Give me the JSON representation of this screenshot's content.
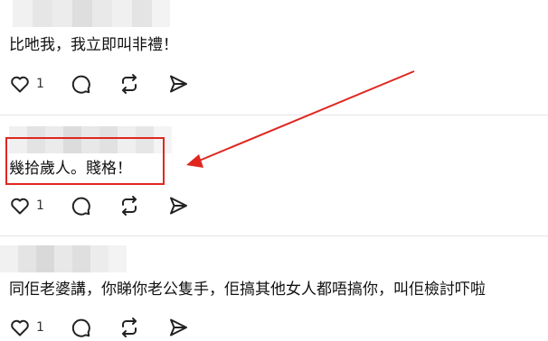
{
  "posts": [
    {
      "text": "比吔我，我立即叫非禮！",
      "like_count": "1"
    },
    {
      "text": "幾拾歲人。賤格！",
      "like_count": "1"
    },
    {
      "text": "同佢老婆講，你睇你老公隻手，佢搞其他女人都唔搞你，叫佢檢討吓啦",
      "like_count": "1"
    }
  ],
  "icons": {
    "like": "heart-icon",
    "comment": "comment-bubble-icon",
    "repost": "repost-icon",
    "share": "send-icon"
  },
  "colors": {
    "annotation": "#e0261f",
    "text": "#111111",
    "icon": "#222222",
    "divider": "#e4e4e4"
  }
}
